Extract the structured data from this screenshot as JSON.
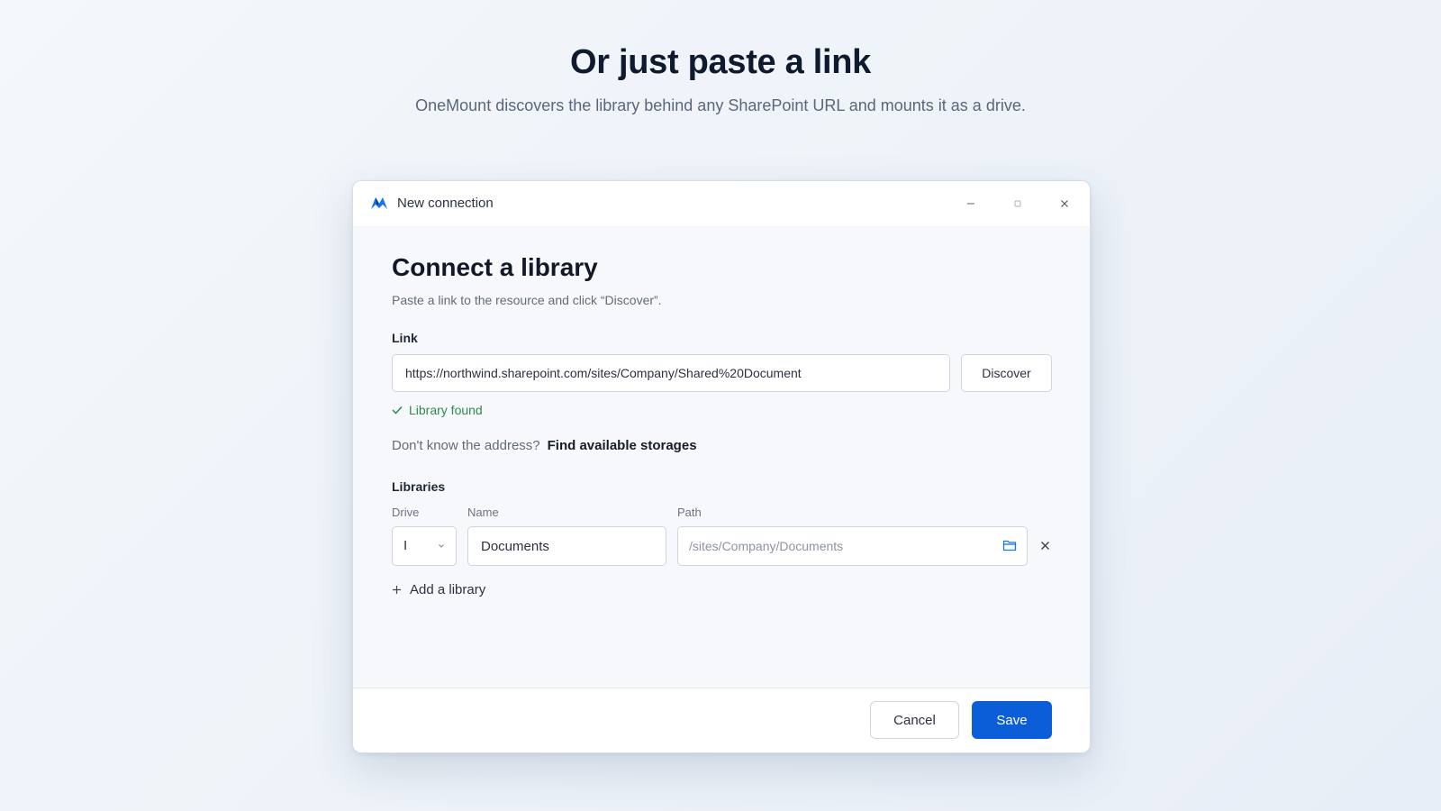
{
  "hero": {
    "title": "Or just paste a link",
    "subtitle": "OneMount discovers the library behind any SharePoint URL and mounts it as a drive."
  },
  "window": {
    "title": "New connection",
    "icons": {
      "logo": "app-logo-icon",
      "minimize": "minimize-icon",
      "maximize": "maximize-icon",
      "close": "close-icon"
    }
  },
  "form": {
    "heading": "Connect a library",
    "subheading": "Paste a link to the resource and click “Discover”.",
    "link_label": "Link",
    "link_value": "https://northwind.sharepoint.com/sites/Company/Shared%20Document",
    "discover_label": "Discover",
    "status_text": "Library found",
    "status_color": "#2e8a4f",
    "hint_text": "Don't know the address?",
    "hint_link": "Find available storages"
  },
  "libraries": {
    "label": "Libraries",
    "columns": {
      "drive": "Drive",
      "name": "Name",
      "path": "Path"
    },
    "rows": [
      {
        "drive": "I",
        "name": "Documents",
        "path_placeholder": "/sites/Company/Documents"
      }
    ],
    "add_label": "Add a library"
  },
  "footer": {
    "cancel_label": "Cancel",
    "save_label": "Save",
    "accent_color": "#0b5ed7"
  }
}
